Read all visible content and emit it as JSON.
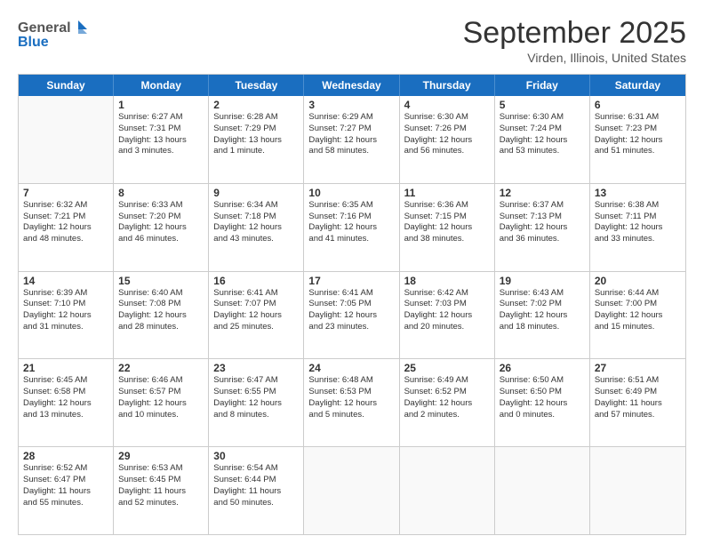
{
  "header": {
    "logo_line1": "General",
    "logo_line2": "Blue",
    "month_title": "September 2025",
    "location": "Virden, Illinois, United States"
  },
  "days_of_week": [
    "Sunday",
    "Monday",
    "Tuesday",
    "Wednesday",
    "Thursday",
    "Friday",
    "Saturday"
  ],
  "weeks": [
    [
      {
        "day": "",
        "text": ""
      },
      {
        "day": "1",
        "text": "Sunrise: 6:27 AM\nSunset: 7:31 PM\nDaylight: 13 hours\nand 3 minutes."
      },
      {
        "day": "2",
        "text": "Sunrise: 6:28 AM\nSunset: 7:29 PM\nDaylight: 13 hours\nand 1 minute."
      },
      {
        "day": "3",
        "text": "Sunrise: 6:29 AM\nSunset: 7:27 PM\nDaylight: 12 hours\nand 58 minutes."
      },
      {
        "day": "4",
        "text": "Sunrise: 6:30 AM\nSunset: 7:26 PM\nDaylight: 12 hours\nand 56 minutes."
      },
      {
        "day": "5",
        "text": "Sunrise: 6:30 AM\nSunset: 7:24 PM\nDaylight: 12 hours\nand 53 minutes."
      },
      {
        "day": "6",
        "text": "Sunrise: 6:31 AM\nSunset: 7:23 PM\nDaylight: 12 hours\nand 51 minutes."
      }
    ],
    [
      {
        "day": "7",
        "text": "Sunrise: 6:32 AM\nSunset: 7:21 PM\nDaylight: 12 hours\nand 48 minutes."
      },
      {
        "day": "8",
        "text": "Sunrise: 6:33 AM\nSunset: 7:20 PM\nDaylight: 12 hours\nand 46 minutes."
      },
      {
        "day": "9",
        "text": "Sunrise: 6:34 AM\nSunset: 7:18 PM\nDaylight: 12 hours\nand 43 minutes."
      },
      {
        "day": "10",
        "text": "Sunrise: 6:35 AM\nSunset: 7:16 PM\nDaylight: 12 hours\nand 41 minutes."
      },
      {
        "day": "11",
        "text": "Sunrise: 6:36 AM\nSunset: 7:15 PM\nDaylight: 12 hours\nand 38 minutes."
      },
      {
        "day": "12",
        "text": "Sunrise: 6:37 AM\nSunset: 7:13 PM\nDaylight: 12 hours\nand 36 minutes."
      },
      {
        "day": "13",
        "text": "Sunrise: 6:38 AM\nSunset: 7:11 PM\nDaylight: 12 hours\nand 33 minutes."
      }
    ],
    [
      {
        "day": "14",
        "text": "Sunrise: 6:39 AM\nSunset: 7:10 PM\nDaylight: 12 hours\nand 31 minutes."
      },
      {
        "day": "15",
        "text": "Sunrise: 6:40 AM\nSunset: 7:08 PM\nDaylight: 12 hours\nand 28 minutes."
      },
      {
        "day": "16",
        "text": "Sunrise: 6:41 AM\nSunset: 7:07 PM\nDaylight: 12 hours\nand 25 minutes."
      },
      {
        "day": "17",
        "text": "Sunrise: 6:41 AM\nSunset: 7:05 PM\nDaylight: 12 hours\nand 23 minutes."
      },
      {
        "day": "18",
        "text": "Sunrise: 6:42 AM\nSunset: 7:03 PM\nDaylight: 12 hours\nand 20 minutes."
      },
      {
        "day": "19",
        "text": "Sunrise: 6:43 AM\nSunset: 7:02 PM\nDaylight: 12 hours\nand 18 minutes."
      },
      {
        "day": "20",
        "text": "Sunrise: 6:44 AM\nSunset: 7:00 PM\nDaylight: 12 hours\nand 15 minutes."
      }
    ],
    [
      {
        "day": "21",
        "text": "Sunrise: 6:45 AM\nSunset: 6:58 PM\nDaylight: 12 hours\nand 13 minutes."
      },
      {
        "day": "22",
        "text": "Sunrise: 6:46 AM\nSunset: 6:57 PM\nDaylight: 12 hours\nand 10 minutes."
      },
      {
        "day": "23",
        "text": "Sunrise: 6:47 AM\nSunset: 6:55 PM\nDaylight: 12 hours\nand 8 minutes."
      },
      {
        "day": "24",
        "text": "Sunrise: 6:48 AM\nSunset: 6:53 PM\nDaylight: 12 hours\nand 5 minutes."
      },
      {
        "day": "25",
        "text": "Sunrise: 6:49 AM\nSunset: 6:52 PM\nDaylight: 12 hours\nand 2 minutes."
      },
      {
        "day": "26",
        "text": "Sunrise: 6:50 AM\nSunset: 6:50 PM\nDaylight: 12 hours\nand 0 minutes."
      },
      {
        "day": "27",
        "text": "Sunrise: 6:51 AM\nSunset: 6:49 PM\nDaylight: 11 hours\nand 57 minutes."
      }
    ],
    [
      {
        "day": "28",
        "text": "Sunrise: 6:52 AM\nSunset: 6:47 PM\nDaylight: 11 hours\nand 55 minutes."
      },
      {
        "day": "29",
        "text": "Sunrise: 6:53 AM\nSunset: 6:45 PM\nDaylight: 11 hours\nand 52 minutes."
      },
      {
        "day": "30",
        "text": "Sunrise: 6:54 AM\nSunset: 6:44 PM\nDaylight: 11 hours\nand 50 minutes."
      },
      {
        "day": "",
        "text": ""
      },
      {
        "day": "",
        "text": ""
      },
      {
        "day": "",
        "text": ""
      },
      {
        "day": "",
        "text": ""
      }
    ]
  ]
}
